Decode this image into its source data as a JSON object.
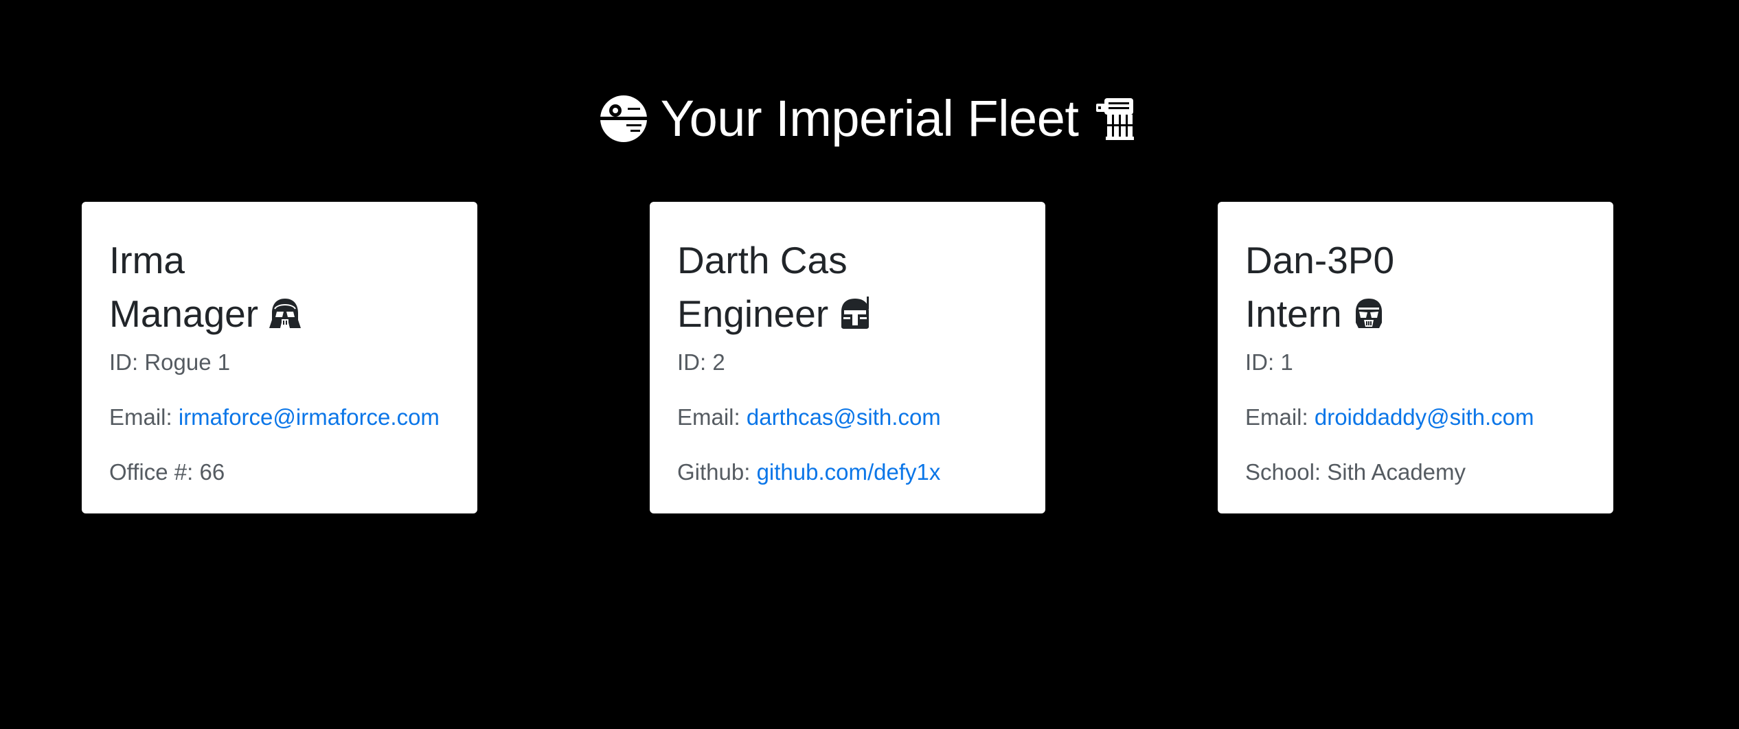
{
  "header": {
    "title": "Your Imperial Fleet",
    "left_icon": "death-star-icon",
    "right_icon": "at-at-walker-icon"
  },
  "colors": {
    "background": "#000000",
    "card": "#ffffff",
    "heading_text": "#212529",
    "body_text": "#555b61",
    "link": "#0b76e8"
  },
  "cards": [
    {
      "name": "Irma",
      "role": "Manager",
      "role_icon": "darth-vader-helmet-icon",
      "id_label": "ID:",
      "id_value": "Rogue 1",
      "email_label": "Email:",
      "email_value": "irmaforce@irmaforce.com",
      "extra_label": "Office #:",
      "extra_value": "66"
    },
    {
      "name": "Darth Cas",
      "role": "Engineer",
      "role_icon": "mandalorian-helmet-icon",
      "id_label": "ID:",
      "id_value": "2",
      "email_label": "Email:",
      "email_value": "darthcas@sith.com",
      "extra_label": "Github:",
      "extra_value": "github.com/defy1x"
    },
    {
      "name": "Dan-3P0",
      "role": "Intern",
      "role_icon": "stormtrooper-helmet-icon",
      "id_label": "ID:",
      "id_value": "1",
      "email_label": "Email:",
      "email_value": "droiddaddy@sith.com",
      "extra_label": "School:",
      "extra_value": "Sith Academy"
    }
  ]
}
